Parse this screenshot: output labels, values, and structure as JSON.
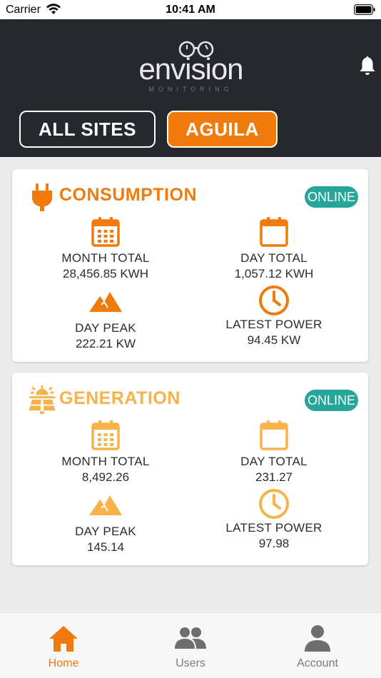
{
  "status_bar": {
    "carrier": "Carrier",
    "time": "10:41 AM"
  },
  "header": {
    "logo_word": "envision",
    "logo_sub": "MONITORING",
    "tabs": [
      {
        "label": "ALL SITES",
        "active": false
      },
      {
        "label": "AGUILA",
        "active": true
      }
    ]
  },
  "colors": {
    "accent": "#f07a0a",
    "generation": "#f7b24a",
    "online": "#26a69a",
    "header_bg": "#25282c"
  },
  "consumption": {
    "title": "CONSUMPTION",
    "icon": "plug-icon",
    "status": "ONLINE",
    "metrics": [
      {
        "label": "MONTH TOTAL",
        "value": "28,456.85 KWH",
        "icon": "calendar-grid-icon"
      },
      {
        "label": "DAY TOTAL",
        "value": "1,057.12 KWH",
        "icon": "calendar-icon"
      },
      {
        "label": "DAY PEAK",
        "value": "222.21 KW",
        "icon": "mountain-icon"
      },
      {
        "label": "LATEST POWER",
        "value": "94.45 KW",
        "icon": "clock-icon"
      }
    ]
  },
  "generation": {
    "title": "GENERATION",
    "icon": "solar-panel-icon",
    "status": "ONLINE",
    "metrics": [
      {
        "label": "MONTH TOTAL",
        "value": "8,492.26",
        "icon": "calendar-grid-icon"
      },
      {
        "label": "DAY TOTAL",
        "value": "231.27",
        "icon": "calendar-icon"
      },
      {
        "label": "DAY PEAK",
        "value": "145.14",
        "icon": "mountain-icon"
      },
      {
        "label": "LATEST POWER",
        "value": "97.98",
        "icon": "clock-icon"
      }
    ]
  },
  "tabbar": {
    "items": [
      {
        "label": "Home",
        "icon": "home-icon",
        "active": true
      },
      {
        "label": "Users",
        "icon": "users-icon",
        "active": false
      },
      {
        "label": "Account",
        "icon": "account-icon",
        "active": false
      }
    ]
  }
}
